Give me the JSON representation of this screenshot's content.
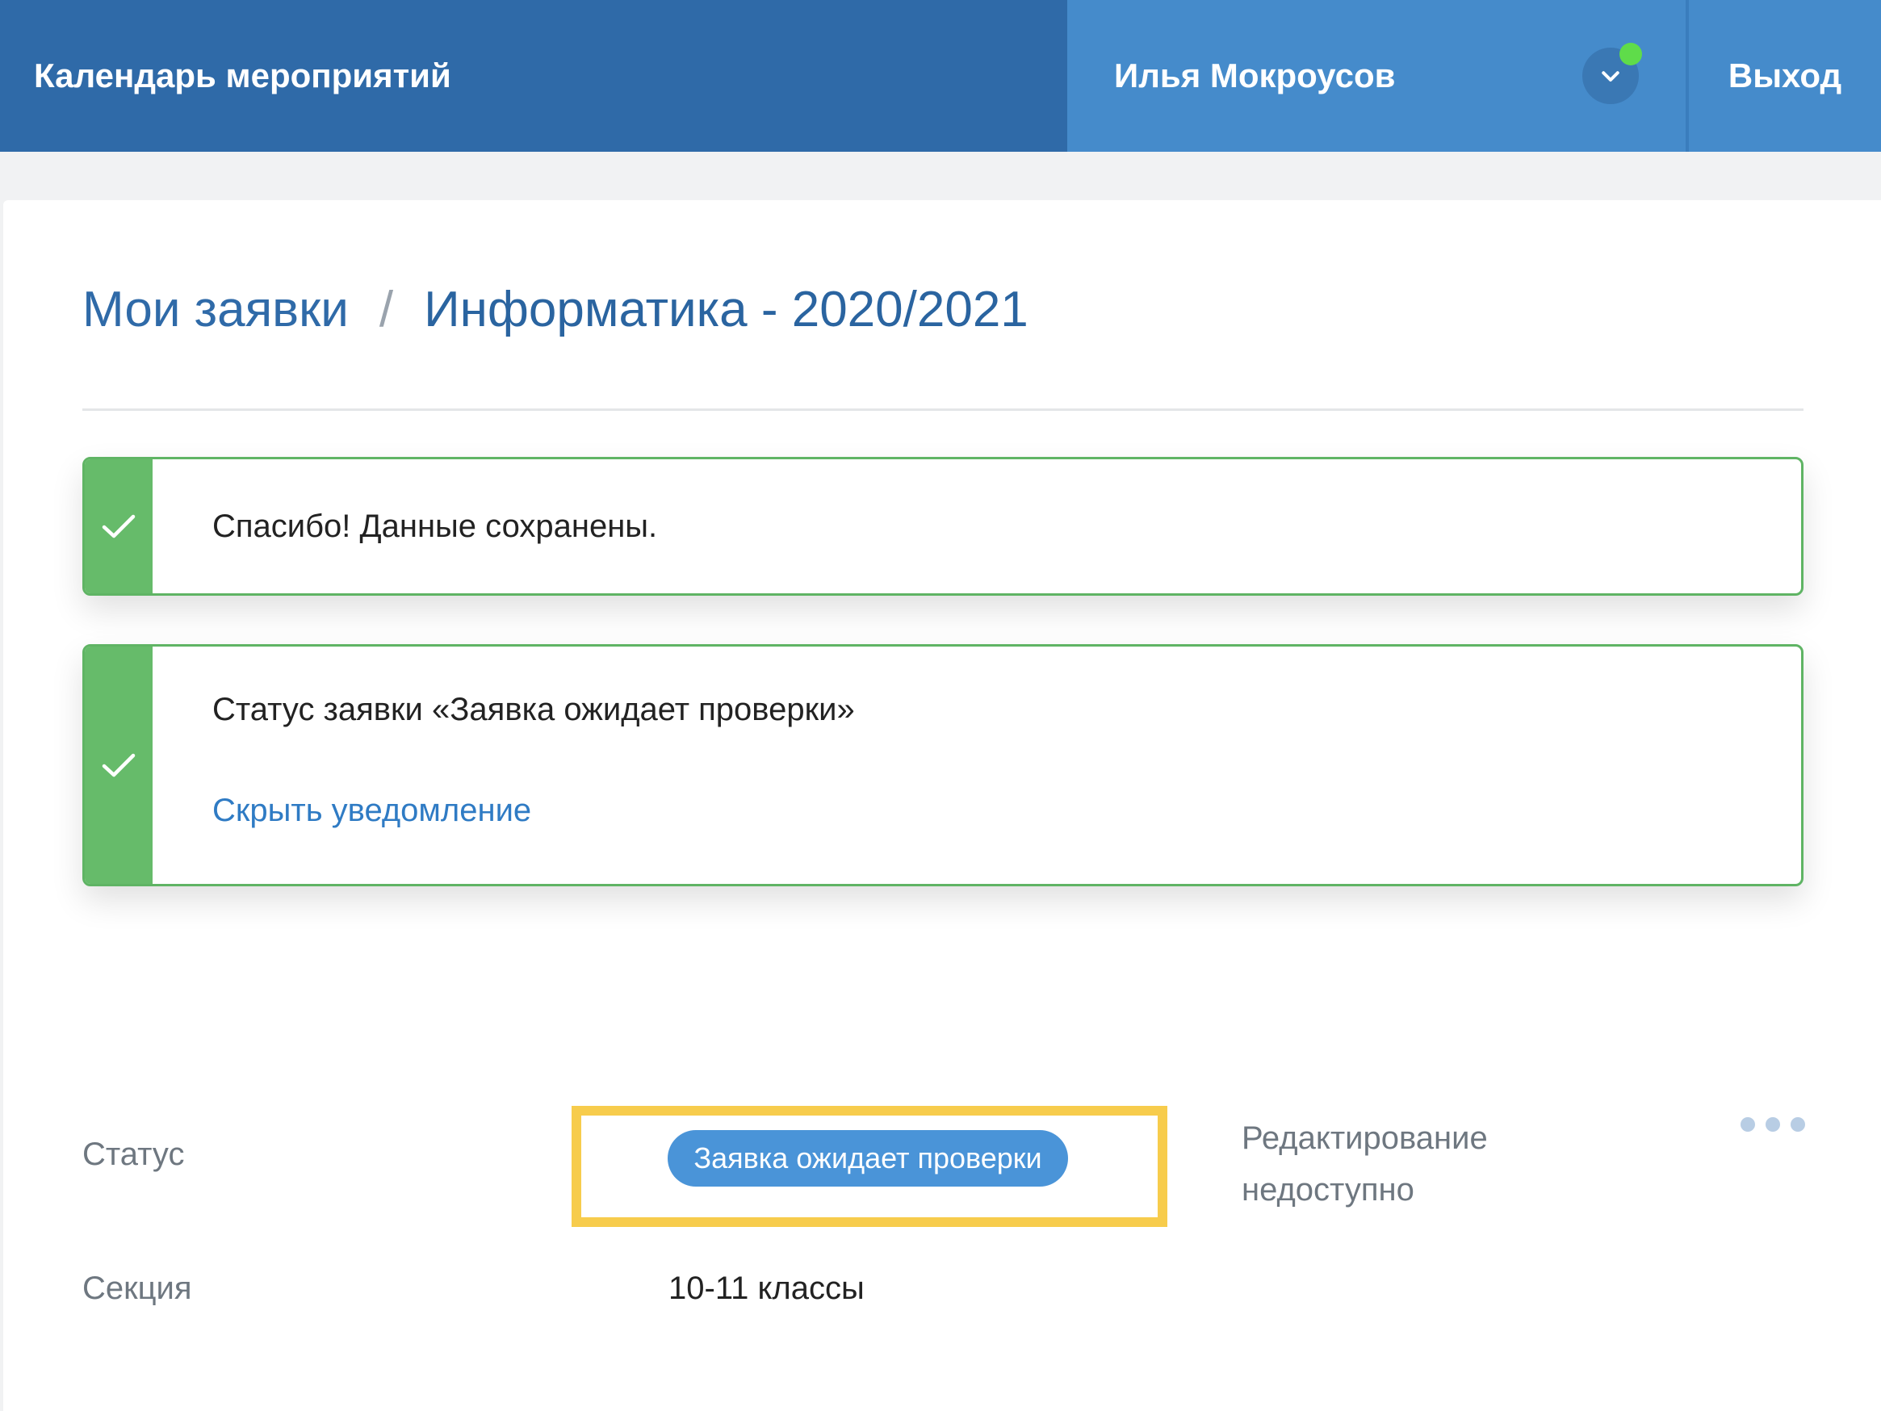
{
  "header": {
    "app_title": "Календарь мероприятий",
    "user_name": "Илья Мокроусов",
    "logout_label": "Выход",
    "online_color": "#5fdc4a",
    "icons": {
      "user_toggle": "chevron-down-icon"
    }
  },
  "breadcrumb": {
    "items": [
      "Мои заявки",
      "Информатика - 2020/2021"
    ],
    "separator": "/"
  },
  "alerts": {
    "saved": {
      "message": "Спасибо! Данные сохранены.",
      "icon": "check-icon"
    },
    "status": {
      "message": "Статус заявки «Заявка ожидает проверки»",
      "hide_label": "Скрыть уведомление",
      "icon": "check-icon"
    },
    "accent_color": "#66bb6a"
  },
  "details": {
    "status_label": "Статус",
    "status_value": "Заявка ожидает проверки",
    "edit_note": "Редактирование недоступно",
    "section_label": "Секция",
    "section_value": "10-11 классы",
    "more_icon": "more-horizontal-icon",
    "highlight_color": "#f7cc4c"
  }
}
